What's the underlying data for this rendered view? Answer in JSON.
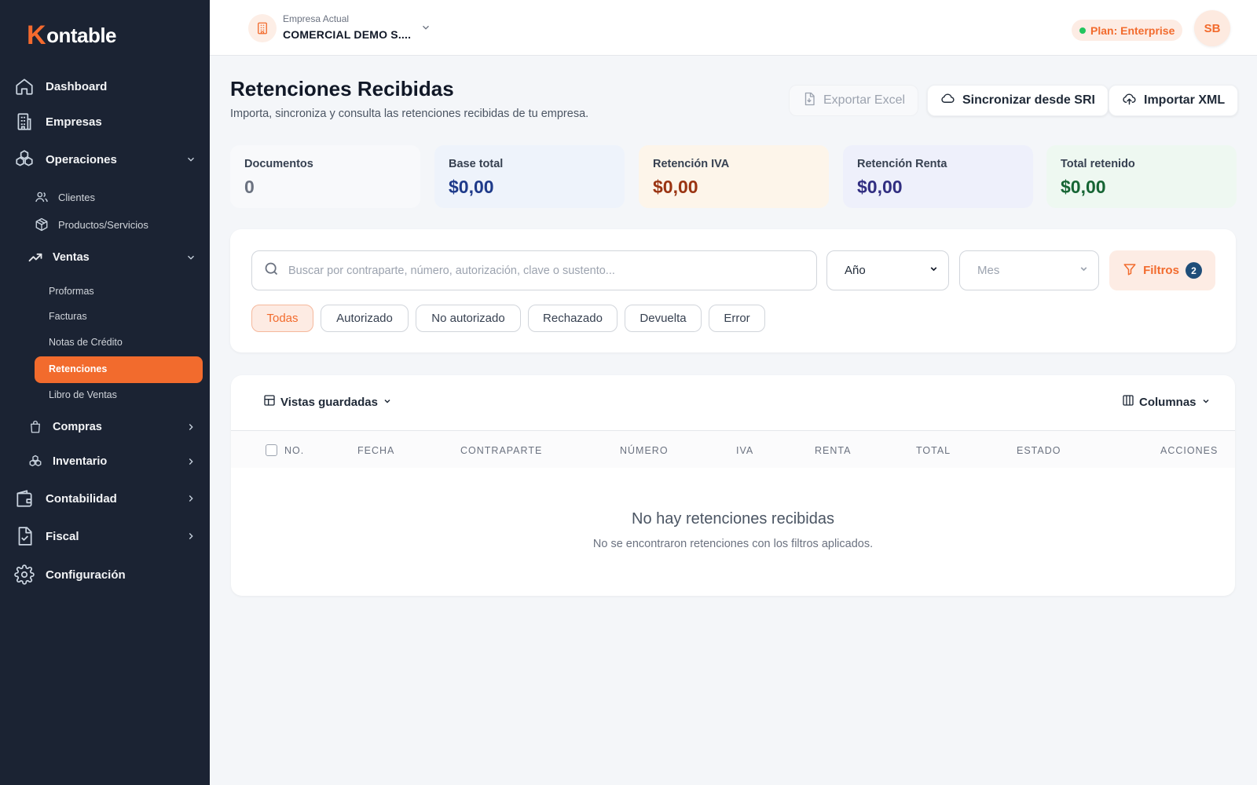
{
  "brand": {
    "logo_k": "K",
    "logo_rest": "ontable"
  },
  "sidebar": {
    "dashboard": "Dashboard",
    "empresas": "Empresas",
    "operaciones": "Operaciones",
    "clientes": "Clientes",
    "productos": "Productos/Servicios",
    "ventas": "Ventas",
    "proformas": "Proformas",
    "facturas": "Facturas",
    "notas_credito": "Notas de Crédito",
    "retenciones": "Retenciones",
    "libro_ventas": "Libro de Ventas",
    "compras": "Compras",
    "inventario": "Inventario",
    "contabilidad": "Contabilidad",
    "fiscal": "Fiscal",
    "configuracion": "Configuración"
  },
  "topbar": {
    "company_label": "Empresa Actual",
    "company_name": "COMERCIAL DEMO S....",
    "plan": "Plan: Enterprise",
    "avatar_initials": "SB"
  },
  "header": {
    "title": "Retenciones Recibidas",
    "subtitle": "Importa, sincroniza y consulta las retenciones recibidas de tu empresa.",
    "export_label": "Exportar Excel",
    "sync_label": "Sincronizar desde SRI",
    "import_label": "Importar XML"
  },
  "stats": [
    {
      "label": "Documentos",
      "value": "0"
    },
    {
      "label": "Base total",
      "value": "$0,00"
    },
    {
      "label": "Retención IVA",
      "value": "$0,00"
    },
    {
      "label": "Retención Renta",
      "value": "$0,00"
    },
    {
      "label": "Total retenido",
      "value": "$0,00"
    }
  ],
  "filters": {
    "search_placeholder": "Buscar por contraparte, número, autorización, clave o sustento...",
    "year_label": "Año",
    "month_label": "Mes",
    "filters_label": "Filtros",
    "filters_count": "2",
    "chips": [
      "Todas",
      "Autorizado",
      "No autorizado",
      "Rechazado",
      "Devuelta",
      "Error"
    ]
  },
  "table": {
    "views_label": "Vistas guardadas",
    "columns_label": "Columnas",
    "headers": [
      "NO.",
      "FECHA",
      "CONTRAPARTE",
      "NÚMERO",
      "IVA",
      "RENTA",
      "TOTAL",
      "ESTADO",
      "ACCIONES"
    ],
    "empty_title": "No hay retenciones recibidas",
    "empty_subtitle": "No se encontraron retenciones con los filtros aplicados."
  },
  "colors": {
    "accent": "#f26b2d",
    "sidebar_bg": "#1b2333",
    "base_total": "#1e3a8a",
    "retencion_iva": "#9a3412",
    "retencion_renta": "#312e81",
    "total_retenido": "#166534",
    "documentos": "#6b7280"
  }
}
